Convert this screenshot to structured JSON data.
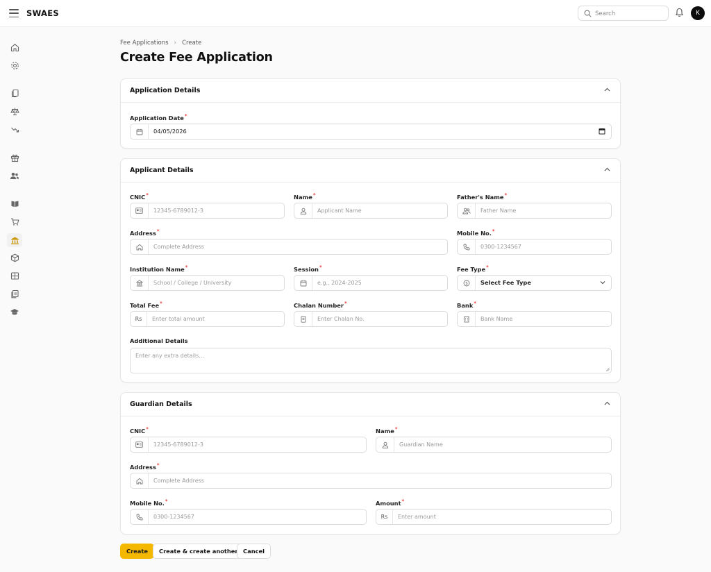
{
  "app": {
    "brand": "SWAES",
    "avatar_initial": "K",
    "accent": "#f5b800"
  },
  "search": {
    "placeholder": "Search"
  },
  "sidebar": {
    "items": [
      {
        "icon": "home-icon"
      },
      {
        "icon": "gear-icon"
      },
      {
        "icon": "documents-icon"
      },
      {
        "icon": "scales-icon"
      },
      {
        "icon": "trend-down-icon"
      },
      {
        "icon": "gift-icon"
      },
      {
        "icon": "users-icon"
      },
      {
        "icon": "book-icon"
      },
      {
        "icon": "cart-icon"
      },
      {
        "icon": "bank-icon",
        "active": true
      },
      {
        "icon": "box-icon"
      },
      {
        "icon": "id-card-icon"
      },
      {
        "icon": "clipboard-icon"
      },
      {
        "icon": "graduation-cap-icon"
      }
    ]
  },
  "breadcrumb": {
    "parent": "Fee Applications",
    "current": "Create"
  },
  "page": {
    "title": "Create Fee Application"
  },
  "application_details": {
    "title": "Application Details",
    "date_label": "Application Date",
    "date_value": "04/05/2026"
  },
  "applicant_details": {
    "title": "Applicant Details",
    "cnic_label": "CNIC",
    "cnic_placeholder": "12345-6789012-3",
    "name_label": "Name",
    "name_placeholder": "Applicant Name",
    "father_label": "Father's Name",
    "father_placeholder": "Father Name",
    "address_label": "Address",
    "address_placeholder": "Complete Address",
    "mobile_label": "Mobile No.",
    "mobile_placeholder": "0300-1234567",
    "institution_label": "Institution Name",
    "institution_placeholder": "School / College / University",
    "session_label": "Session",
    "session_placeholder": "e.g., 2024-2025",
    "fee_type_label": "Fee Type",
    "fee_type_value": "Select Fee Type",
    "total_fee_label": "Total Fee",
    "total_fee_prefix": "Rs",
    "total_fee_placeholder": "Enter total amount",
    "chalan_label": "Chalan Number",
    "chalan_placeholder": "Enter Chalan No.",
    "bank_label": "Bank",
    "bank_placeholder": "Bank Name",
    "additional_label": "Additional Details",
    "additional_placeholder": "Enter any extra details..."
  },
  "guardian_details": {
    "title": "Guardian Details",
    "cnic_label": "CNIC",
    "cnic_placeholder": "12345-6789012-3",
    "name_label": "Name",
    "name_placeholder": "Guardian Name",
    "address_label": "Address",
    "address_placeholder": "Complete Address",
    "mobile_label": "Mobile No.",
    "mobile_placeholder": "0300-1234567",
    "amount_label": "Amount",
    "amount_prefix": "Rs",
    "amount_placeholder": "Enter amount"
  },
  "actions": {
    "create": "Create",
    "create_another": "Create & create another",
    "cancel": "Cancel"
  }
}
